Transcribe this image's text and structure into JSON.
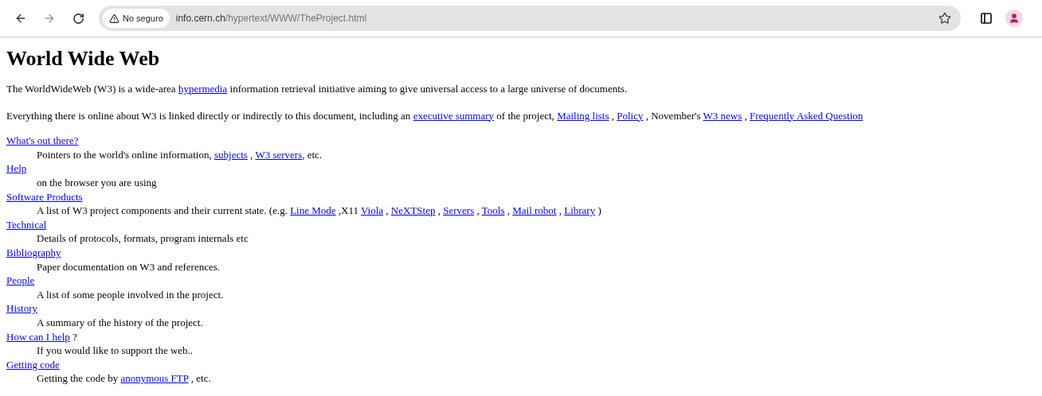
{
  "toolbar": {
    "back": {
      "disabled": false
    },
    "forward": {
      "disabled": true
    },
    "security_chip": "No seguro",
    "url": {
      "host": "info.cern.ch",
      "path": "/hypertext/WWW/TheProject.html"
    }
  },
  "page": {
    "title": "World Wide Web",
    "paragraphs": [
      [
        {
          "kind": "text",
          "text": "The WorldWideWeb (W3) is a wide-area "
        },
        {
          "kind": "link",
          "text": "hypermedia"
        },
        {
          "kind": "text",
          "text": " information retrieval initiative aiming to give universal access to a large universe of documents."
        }
      ],
      [
        {
          "kind": "text",
          "text": "Everything there is online about W3 is linked directly or indirectly to this document, including an "
        },
        {
          "kind": "link",
          "text": "executive summary"
        },
        {
          "kind": "text",
          "text": " of the project, "
        },
        {
          "kind": "link",
          "text": "Mailing lists"
        },
        {
          "kind": "text",
          "text": " , "
        },
        {
          "kind": "link",
          "text": "Policy"
        },
        {
          "kind": "text",
          "text": " , November's "
        },
        {
          "kind": "link",
          "text": "W3 news"
        },
        {
          "kind": "text",
          "text": " , "
        },
        {
          "kind": "link",
          "text": "Frequently Asked Question"
        }
      ]
    ],
    "entries": [
      {
        "term": [
          {
            "kind": "link",
            "text": "What's out there?"
          }
        ],
        "description": [
          {
            "kind": "text",
            "text": "Pointers to the world's online information, "
          },
          {
            "kind": "link",
            "text": "subjects"
          },
          {
            "kind": "text",
            "text": " , "
          },
          {
            "kind": "link",
            "text": "W3 servers"
          },
          {
            "kind": "text",
            "text": ", etc."
          }
        ]
      },
      {
        "term": [
          {
            "kind": "link",
            "text": "Help"
          }
        ],
        "description": [
          {
            "kind": "text",
            "text": "on the browser you are using"
          }
        ]
      },
      {
        "term": [
          {
            "kind": "link",
            "text": "Software Products"
          }
        ],
        "description": [
          {
            "kind": "text",
            "text": "A list of W3 project components and their current state. (e.g. "
          },
          {
            "kind": "link",
            "text": "Line Mode"
          },
          {
            "kind": "text",
            "text": " ,X11 "
          },
          {
            "kind": "link",
            "text": "Viola"
          },
          {
            "kind": "text",
            "text": " , "
          },
          {
            "kind": "link",
            "text": "NeXTStep"
          },
          {
            "kind": "text",
            "text": " , "
          },
          {
            "kind": "link",
            "text": "Servers"
          },
          {
            "kind": "text",
            "text": " , "
          },
          {
            "kind": "link",
            "text": "Tools"
          },
          {
            "kind": "text",
            "text": " , "
          },
          {
            "kind": "link",
            "text": "Mail robot"
          },
          {
            "kind": "text",
            "text": " , "
          },
          {
            "kind": "link",
            "text": "Library"
          },
          {
            "kind": "text",
            "text": " )"
          }
        ]
      },
      {
        "term": [
          {
            "kind": "link",
            "text": "Technical"
          }
        ],
        "description": [
          {
            "kind": "text",
            "text": "Details of protocols, formats, program internals etc"
          }
        ]
      },
      {
        "term": [
          {
            "kind": "link",
            "text": "Bibliography"
          }
        ],
        "description": [
          {
            "kind": "text",
            "text": "Paper documentation on W3 and references."
          }
        ]
      },
      {
        "term": [
          {
            "kind": "link",
            "text": "People"
          }
        ],
        "description": [
          {
            "kind": "text",
            "text": "A list of some people involved in the project."
          }
        ]
      },
      {
        "term": [
          {
            "kind": "link",
            "text": "History"
          }
        ],
        "description": [
          {
            "kind": "text",
            "text": "A summary of the history of the project."
          }
        ]
      },
      {
        "term": [
          {
            "kind": "link",
            "text": "How can I help"
          },
          {
            "kind": "text",
            "text": " ?"
          }
        ],
        "description": [
          {
            "kind": "text",
            "text": "If you would like to support the web.."
          }
        ]
      },
      {
        "term": [
          {
            "kind": "link",
            "text": "Getting code"
          }
        ],
        "description": [
          {
            "kind": "text",
            "text": "Getting the code by "
          },
          {
            "kind": "link",
            "text": "anonymous FTP"
          },
          {
            "kind": "text",
            "text": " , etc."
          }
        ]
      }
    ]
  }
}
